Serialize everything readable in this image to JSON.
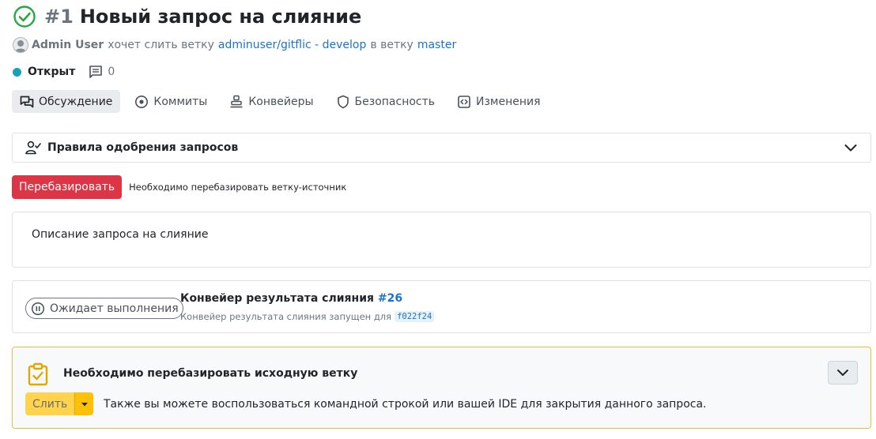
{
  "header": {
    "number": "#1",
    "title": "Новый запрос на слияние"
  },
  "subtitle": {
    "author": "Admin User",
    "text_wants": "хочет слить ветку",
    "source_branch": "adminuser/gitflic - develop",
    "text_into": "в ветку",
    "target_branch": "master"
  },
  "status": {
    "label": "Открыт",
    "comment_count": "0",
    "dot_color": "#17a2b8"
  },
  "tabs": [
    {
      "label": "Обсуждение",
      "icon": "discussion-icon",
      "active": true
    },
    {
      "label": "Коммиты",
      "icon": "commit-icon"
    },
    {
      "label": "Конвейеры",
      "icon": "pipeline-icon"
    },
    {
      "label": "Безопасность",
      "icon": "shield-icon"
    },
    {
      "label": "Изменения",
      "icon": "code-icon"
    }
  ],
  "approval": {
    "title": "Правила одобрения запросов"
  },
  "rebase": {
    "button_label": "Перебазировать",
    "note": "Необходимо перебазировать ветку-источник",
    "color": "#dc3545"
  },
  "description": {
    "text": "Описание запроса на слияние"
  },
  "pipeline": {
    "status": "Ожидает выполнения",
    "title": "Конвейер результата слияния",
    "number": "#26",
    "subtitle": "Конвейер результата слияния запущен для",
    "commit": "f022f24"
  },
  "merge": {
    "title": "Необходимо перебазировать исходную ветку",
    "button_label": "Слить",
    "note": "Также вы можете воспользоваться командной строкой или вашей IDE для закрытия данного запроса.",
    "accent_color": "#ffc107"
  }
}
